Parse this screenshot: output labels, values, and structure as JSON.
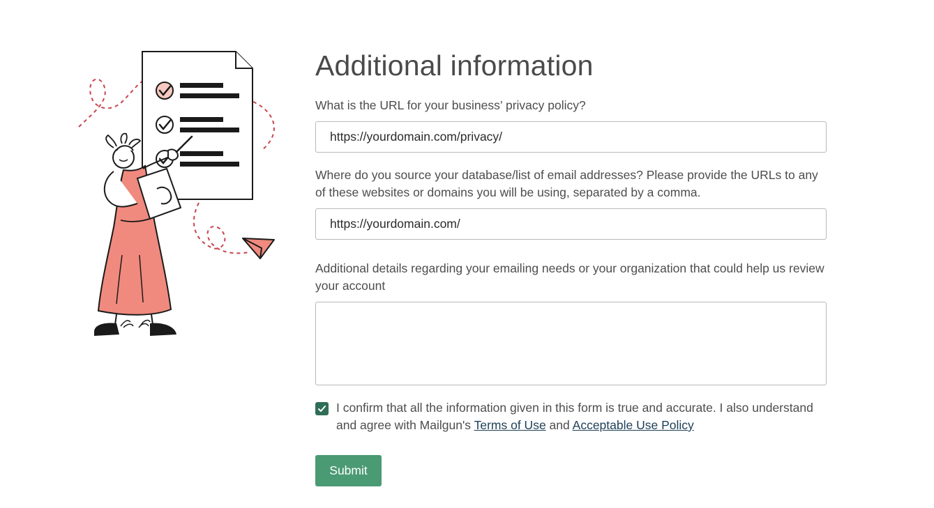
{
  "form": {
    "title": "Additional information",
    "privacy_label": "What is the URL for your business’ privacy policy?",
    "privacy_value": "https://yourdomain.com/privacy/",
    "source_label": "Where do you source your database/list of email addresses? Please provide the URLs to any of these websites or domains you will be using, separated by a comma.",
    "source_value": "https://yourdomain.com/",
    "details_label": "Additional details regarding your emailing needs or your organization that could help us review your account",
    "details_value": "",
    "consent_checked": true,
    "consent_text_1": "I confirm that all the information given in this form is true and accurate. I also understand and agree with Mailgun's ",
    "terms_link": "Terms of Use",
    "consent_and": " and ",
    "aup_link": "Acceptable Use Policy",
    "submit_label": "Submit"
  },
  "colors": {
    "accent": "#4a9a74",
    "checkbox": "#2f6e57",
    "link": "#1e3f57",
    "illustration_coral": "#f08a7e"
  },
  "illustration": {
    "icon": "hermes-checklist-illustration"
  }
}
